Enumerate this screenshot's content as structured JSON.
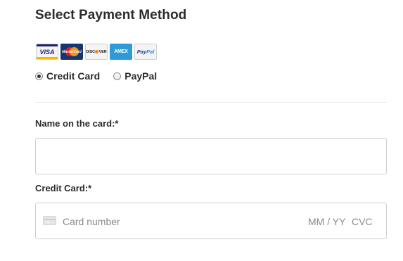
{
  "header": {
    "title": "Select Payment Method"
  },
  "card_logos": [
    {
      "name": "visa",
      "label": "VISA"
    },
    {
      "name": "mastercard",
      "label": "MasterCard"
    },
    {
      "name": "discover",
      "label": "DISC VER"
    },
    {
      "name": "amex",
      "label": "AMEX"
    },
    {
      "name": "paypal",
      "label_a": "Pay",
      "label_b": "Pal"
    }
  ],
  "payment_options": {
    "credit_card": {
      "label": "Credit Card",
      "checked": true
    },
    "paypal": {
      "label": "PayPal",
      "checked": false
    }
  },
  "form": {
    "name_label": "Name on the card:*",
    "name_value": "",
    "credit_card_label": "Credit Card:*",
    "card_number_placeholder": "Card number",
    "expiry_placeholder": "MM / YY",
    "cvc_placeholder": "CVC"
  },
  "colors": {
    "text": "#2b2b2b",
    "placeholder": "#8a8a8a",
    "border": "#cfcfcf",
    "divider": "#ebebeb",
    "amex": "#2e9ad8",
    "mastercard_bg": "#16366f"
  },
  "icons": {
    "card_field_icon": "credit-card-icon"
  }
}
